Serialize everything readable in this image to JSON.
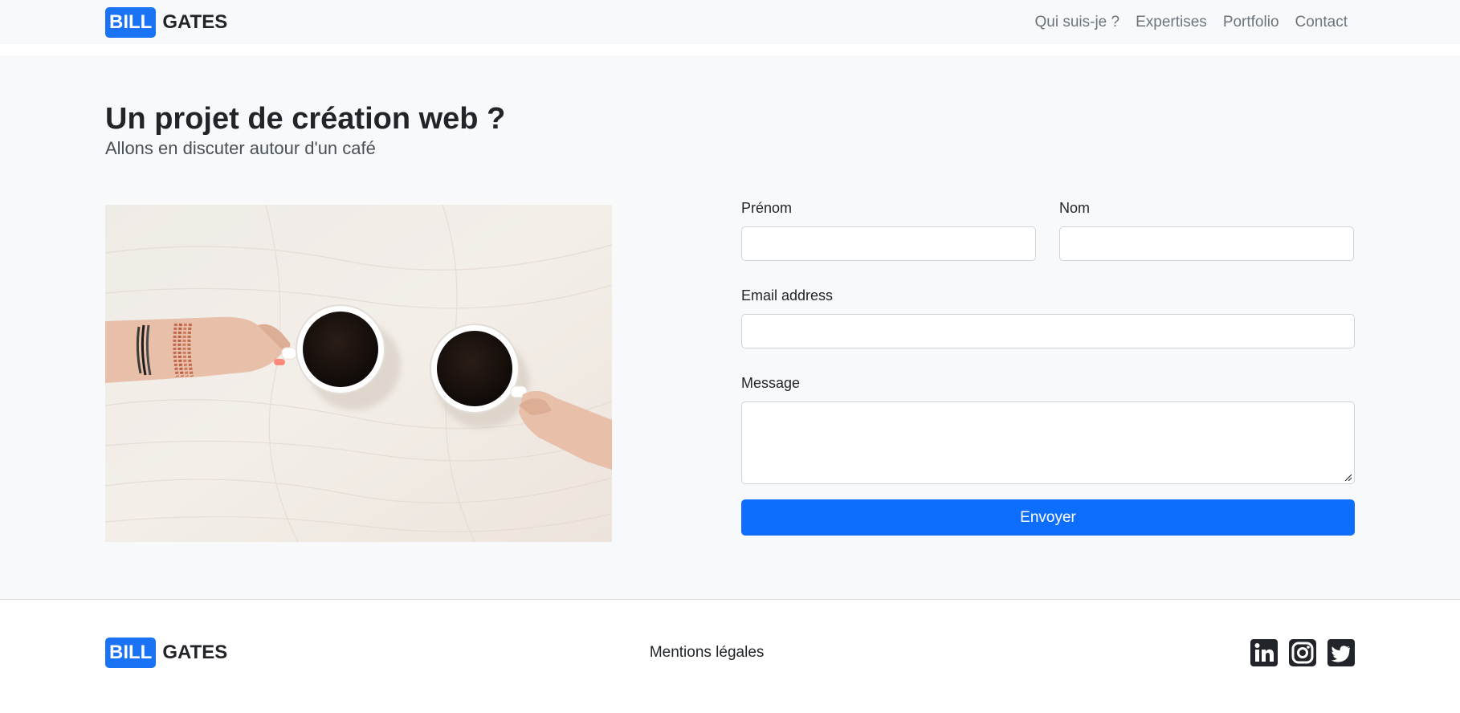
{
  "brand": {
    "badge": "BILL",
    "name": "GATES"
  },
  "nav": {
    "items": [
      {
        "label": "Qui suis-je ?"
      },
      {
        "label": "Expertises"
      },
      {
        "label": "Portfolio"
      },
      {
        "label": "Contact"
      }
    ]
  },
  "hero": {
    "title": "Un projet de création web ?",
    "subtitle": "Allons en discuter autour d'un café"
  },
  "form": {
    "first_name_label": "Prénom",
    "first_name_value": "",
    "last_name_label": "Nom",
    "last_name_value": "",
    "email_label": "Email address",
    "email_value": "",
    "message_label": "Message",
    "message_value": "",
    "submit_label": "Envoyer"
  },
  "footer": {
    "brand_badge": "BILL",
    "brand_name": "GATES",
    "legal_link": "Mentions légales",
    "socials": [
      "linkedin-icon",
      "instagram-icon",
      "twitter-icon"
    ]
  },
  "colors": {
    "accent": "#0d6efd",
    "brand_badge": "#1a73f5",
    "background_light": "#f8f9fa"
  }
}
